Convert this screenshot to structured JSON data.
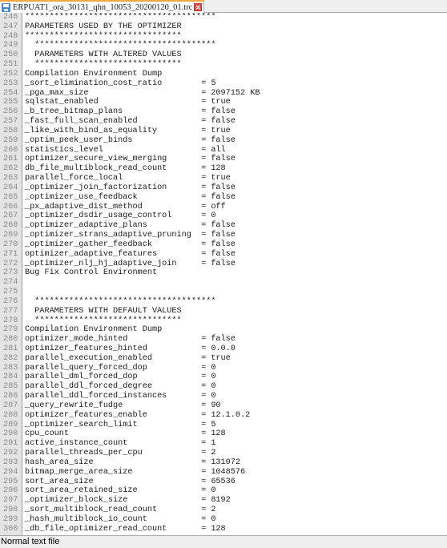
{
  "tab": {
    "filename": "ERPUAT1_ora_30131_qhn_10053_20200120_01.trc",
    "icon": "save-icon",
    "close_icon": "close-icon",
    "accent_color": "#f4a742"
  },
  "editor": {
    "lines": [
      {
        "n": "246",
        "text": "***************************************"
      },
      {
        "n": "247",
        "text": "PARAMETERS USED BY THE OPTIMIZER"
      },
      {
        "n": "248",
        "text": "********************************"
      },
      {
        "n": "249",
        "text": "  *************************************"
      },
      {
        "n": "250",
        "text": "  PARAMETERS WITH ALTERED VALUES"
      },
      {
        "n": "251",
        "text": "  ******************************"
      },
      {
        "n": "252",
        "text": "Compilation Environment Dump"
      },
      {
        "n": "253",
        "text": "_sort_elimination_cost_ratio        = 5"
      },
      {
        "n": "254",
        "text": "_pga_max_size                       = 2097152 KB"
      },
      {
        "n": "255",
        "text": "sqlstat_enabled                     = true"
      },
      {
        "n": "256",
        "text": "_b_tree_bitmap_plans                = false"
      },
      {
        "n": "257",
        "text": "_fast_full_scan_enabled             = false"
      },
      {
        "n": "258",
        "text": "_like_with_bind_as_equality         = true"
      },
      {
        "n": "259",
        "text": "_optim_peek_user_binds              = false"
      },
      {
        "n": "260",
        "text": "statistics_level                    = all"
      },
      {
        "n": "261",
        "text": "optimizer_secure_view_merging       = false"
      },
      {
        "n": "262",
        "text": "db_file_multiblock_read_count       = 128"
      },
      {
        "n": "263",
        "text": "parallel_force_local                = true"
      },
      {
        "n": "264",
        "text": "_optimizer_join_factorization       = false"
      },
      {
        "n": "265",
        "text": "_optimizer_use_feedback             = false"
      },
      {
        "n": "266",
        "text": "_px_adaptive_dist_method            = off"
      },
      {
        "n": "267",
        "text": "_optimizer_dsdir_usage_control      = 0"
      },
      {
        "n": "268",
        "text": "_optimizer_adaptive_plans           = false"
      },
      {
        "n": "269",
        "text": "_optimizer_strans_adaptive_pruning  = false"
      },
      {
        "n": "270",
        "text": "_optimizer_gather_feedback          = false"
      },
      {
        "n": "271",
        "text": "optimizer_adaptive_features         = false"
      },
      {
        "n": "272",
        "text": "_optimizer_nlj_hj_adaptive_join     = false"
      },
      {
        "n": "273",
        "text": "Bug Fix Control Environment"
      },
      {
        "n": "274",
        "text": ""
      },
      {
        "n": "275",
        "text": ""
      },
      {
        "n": "276",
        "text": "  *************************************"
      },
      {
        "n": "277",
        "text": "  PARAMETERS WITH DEFAULT VALUES"
      },
      {
        "n": "278",
        "text": "  ******************************"
      },
      {
        "n": "279",
        "text": "Compilation Environment Dump"
      },
      {
        "n": "280",
        "text": "optimizer_mode_hinted               = false"
      },
      {
        "n": "281",
        "text": "optimizer_features_hinted           = 0.0.0"
      },
      {
        "n": "282",
        "text": "parallel_execution_enabled          = true"
      },
      {
        "n": "283",
        "text": "parallel_query_forced_dop           = 0"
      },
      {
        "n": "284",
        "text": "parallel_dml_forced_dop             = 0"
      },
      {
        "n": "285",
        "text": "parallel_ddl_forced_degree          = 0"
      },
      {
        "n": "286",
        "text": "parallel_ddl_forced_instances       = 0"
      },
      {
        "n": "287",
        "text": "_query_rewrite_fudge                = 90"
      },
      {
        "n": "288",
        "text": "optimizer_features_enable           = 12.1.0.2"
      },
      {
        "n": "289",
        "text": "_optimizer_search_limit             = 5"
      },
      {
        "n": "290",
        "text": "cpu_count                           = 128"
      },
      {
        "n": "291",
        "text": "active_instance_count               = 1"
      },
      {
        "n": "292",
        "text": "parallel_threads_per_cpu            = 2"
      },
      {
        "n": "293",
        "text": "hash_area_size                      = 131072"
      },
      {
        "n": "294",
        "text": "bitmap_merge_area_size              = 1048576"
      },
      {
        "n": "295",
        "text": "sort_area_size                      = 65536"
      },
      {
        "n": "296",
        "text": "sort_area_retained_size             = 0"
      },
      {
        "n": "297",
        "text": "_optimizer_block_size               = 8192"
      },
      {
        "n": "298",
        "text": "_sort_multiblock_read_count         = 2"
      },
      {
        "n": "299",
        "text": "_hash_multiblock_io_count           = 0"
      },
      {
        "n": "300",
        "text": "_db_file_optimizer_read_count       = 128"
      }
    ]
  },
  "statusbar": {
    "file_type": "Normal text file"
  }
}
